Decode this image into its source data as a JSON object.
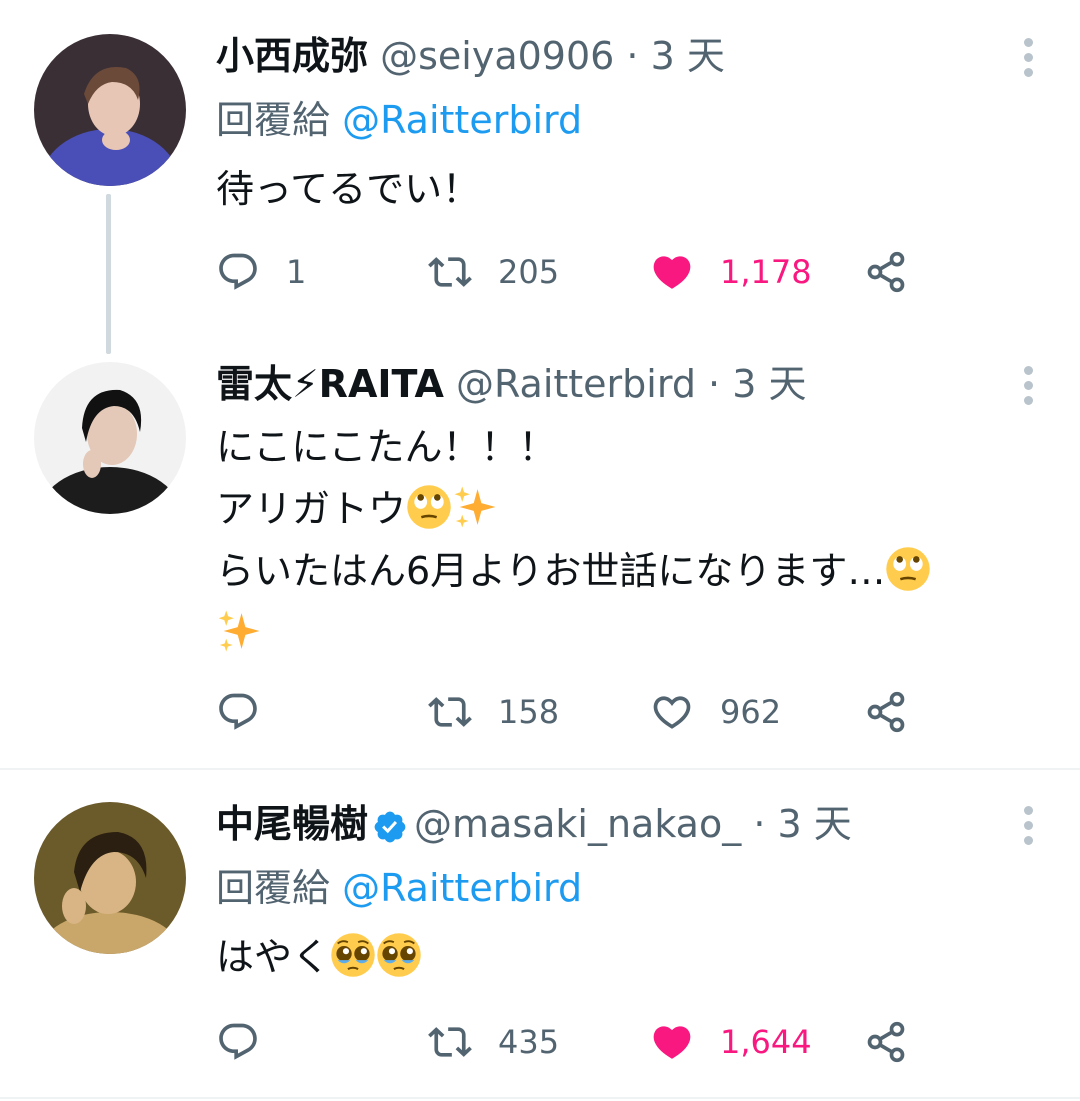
{
  "tweets": [
    {
      "name": "小西成弥",
      "handle": "@seiya0906",
      "separator": "·",
      "time": "3 天",
      "reply_prefix": "回覆給",
      "reply_to": "@Raitterbird",
      "text_lines": [
        "待ってるでい！"
      ],
      "replies": "1",
      "retweets": "205",
      "likes": "1,178",
      "liked": true,
      "verified": false
    },
    {
      "name": "雷太⚡RAITA",
      "handle": "@Raitterbird",
      "separator": "·",
      "time": "3 天",
      "text_lines": [
        "にこにこたん！！！",
        "アリガトウ",
        "らいたはん6月よりお世話になります…"
      ],
      "emojis": [
        "face-with-rolling-eyes",
        "sparkles"
      ],
      "replies": "",
      "retweets": "158",
      "likes": "962",
      "liked": false,
      "verified": false
    },
    {
      "name": "中尾暢樹",
      "handle": "@masaki_nakao_",
      "separator": "·",
      "time": "3 天",
      "reply_prefix": "回覆給",
      "reply_to": "@Raitterbird",
      "text_lines": [
        "はやく"
      ],
      "emojis": [
        "pleading-face",
        "pleading-face"
      ],
      "replies": "",
      "retweets": "435",
      "likes": "1,644",
      "liked": true,
      "verified": true
    }
  ],
  "colors": {
    "like_active": "#f91880",
    "link": "#1d9bf0",
    "secondary_text": "#536471",
    "verified": "#1d9bf0"
  }
}
